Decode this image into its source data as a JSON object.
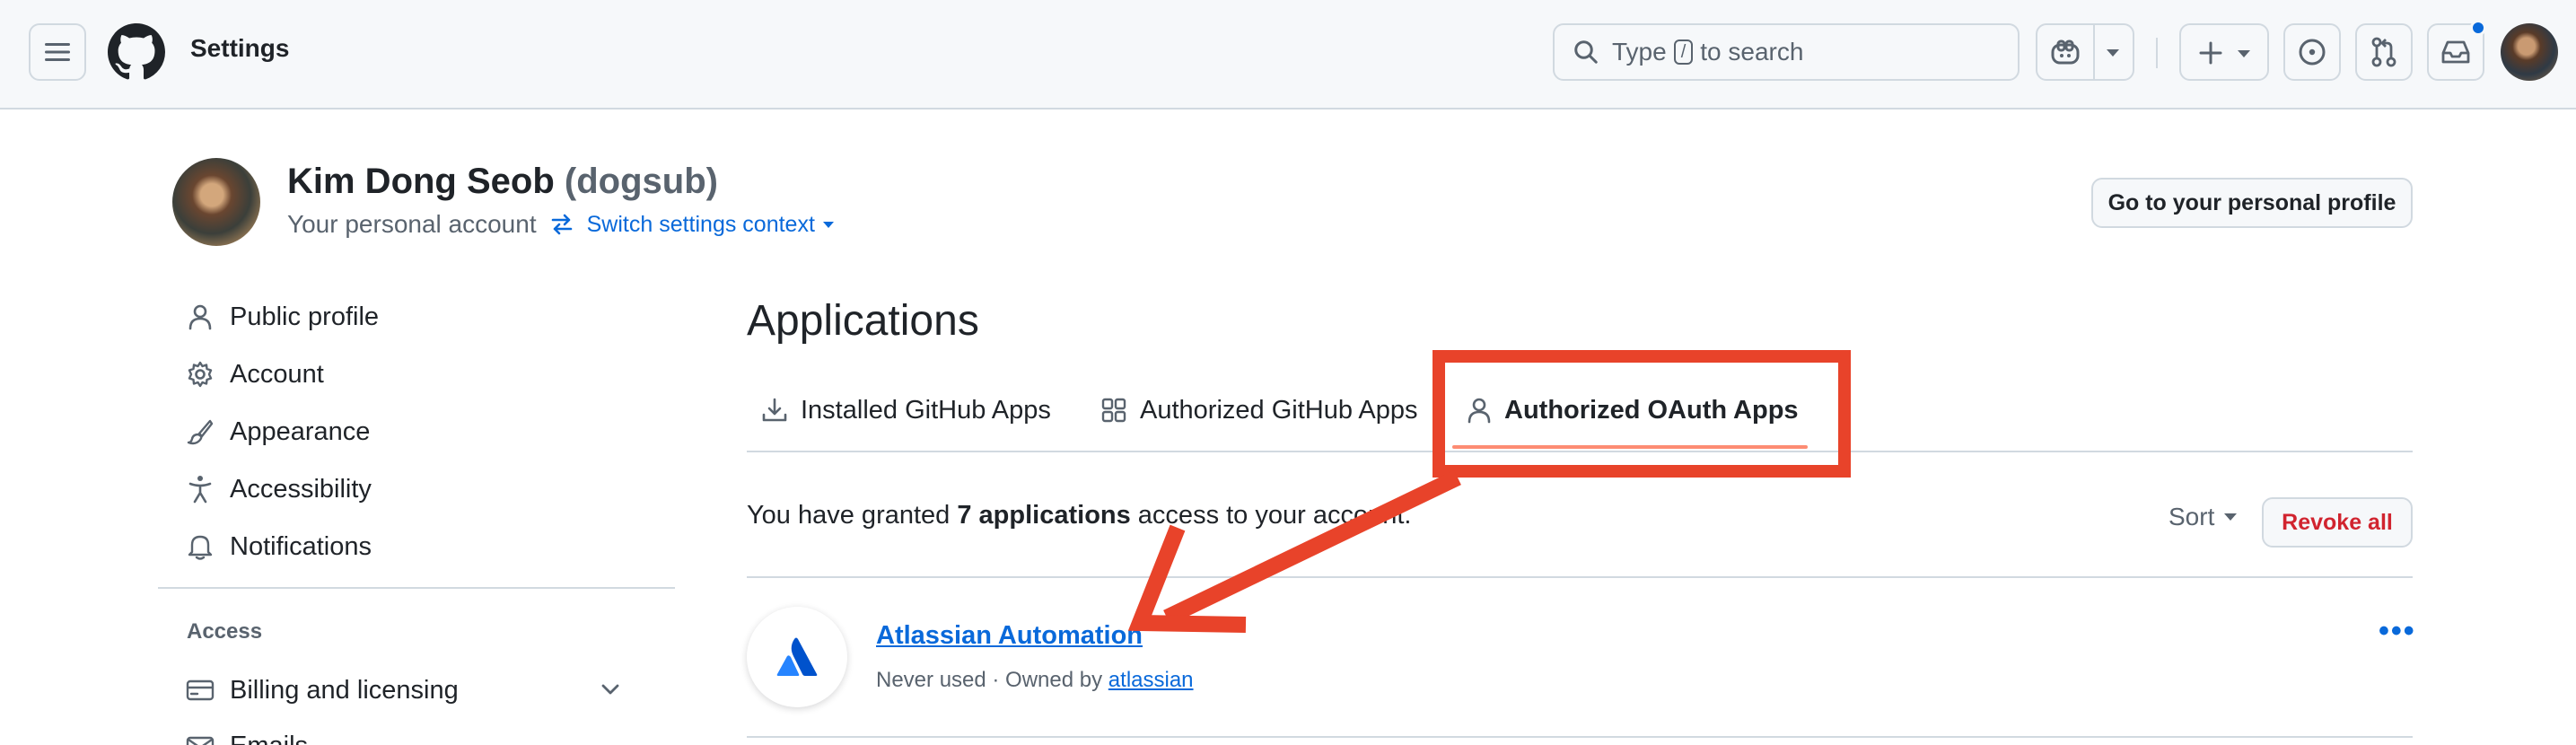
{
  "header": {
    "context_title": "Settings",
    "search": {
      "prefix": "Type",
      "kbd": "/",
      "suffix": "to search"
    },
    "icons": [
      "hamburger-icon",
      "github-mark-icon",
      "search-icon",
      "copilot-icon",
      "triangle-down-icon",
      "plus-icon",
      "issue-icon",
      "pull-request-icon",
      "inbox-icon"
    ],
    "notification_dot_color": "#0969da"
  },
  "account": {
    "display_name": "Kim Dong Seob",
    "login": "(dogsub)",
    "subtitle": "Your personal account",
    "switch_label": "Switch settings context",
    "profile_button": "Go to your personal profile"
  },
  "sidebar": {
    "items": [
      {
        "label": "Public profile",
        "icon": "person-icon"
      },
      {
        "label": "Account",
        "icon": "gear-icon"
      },
      {
        "label": "Appearance",
        "icon": "paintbrush-icon"
      },
      {
        "label": "Accessibility",
        "icon": "accessibility-icon"
      },
      {
        "label": "Notifications",
        "icon": "bell-icon"
      }
    ],
    "access_heading": "Access",
    "access_items": [
      {
        "label": "Billing and licensing",
        "icon": "credit-card-icon"
      },
      {
        "label": "Emails",
        "icon": "mail-icon"
      }
    ]
  },
  "main": {
    "title": "Applications",
    "tabs": [
      {
        "label": "Installed GitHub Apps",
        "icon": "download-icon",
        "selected": false
      },
      {
        "label": "Authorized GitHub Apps",
        "icon": "apps-icon",
        "selected": false
      },
      {
        "label": "Authorized OAuth Apps",
        "icon": "person-icon",
        "selected": true
      }
    ],
    "grant": {
      "before": "You have granted ",
      "count": "7 applications",
      "after": " access to your account."
    },
    "sort_label": "Sort",
    "revoke_all_label": "Revoke all",
    "apps": [
      {
        "name": "Atlassian Automation",
        "usage": "Never used · Owned by ",
        "owner": "atlassian",
        "logo": "atlassian-logo-icon"
      }
    ]
  },
  "colors": {
    "accent": "#0969da",
    "danger": "#d1242f",
    "selected_tab_underline": "#fd8c73",
    "annotation": "#e8432a",
    "atlassian_blue": "#2684ff"
  }
}
